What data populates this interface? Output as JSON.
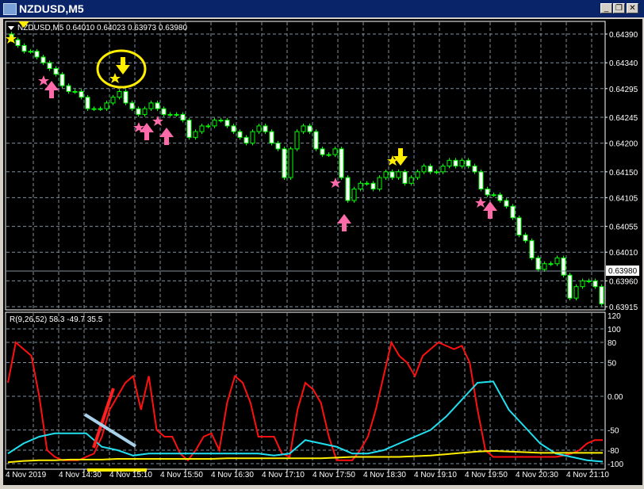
{
  "window": {
    "title": "NZDUSD,M5",
    "buttons": [
      "minimize",
      "restore",
      "close"
    ]
  },
  "chart": {
    "header": "NZDUSD,M5  0.64010 0.64023 0.63973 0.63980",
    "current_price": "0.63980",
    "price_labels": [
      "0.64390",
      "0.64340",
      "0.64295",
      "0.64245",
      "0.64200",
      "0.64150",
      "0.64105",
      "0.64055",
      "0.64010",
      "0.63960",
      "0.63915"
    ],
    "closes": [
      0.6438,
      0.6437,
      0.6436,
      0.6436,
      0.6435,
      0.6434,
      0.6433,
      0.6432,
      0.643,
      0.6429,
      0.6429,
      0.6428,
      0.6426,
      0.6426,
      0.6426,
      0.6427,
      0.6428,
      0.6429,
      0.6427,
      0.6426,
      0.6425,
      0.6426,
      0.6427,
      0.6426,
      0.6425,
      0.6425,
      0.6425,
      0.6424,
      0.6421,
      0.6422,
      0.6423,
      0.6423,
      0.6424,
      0.6424,
      0.6423,
      0.6422,
      0.6421,
      0.642,
      0.6422,
      0.6423,
      0.6422,
      0.642,
      0.6419,
      0.6414,
      0.6419,
      0.6422,
      0.6423,
      0.6422,
      0.6419,
      0.6418,
      0.6418,
      0.6419,
      0.6414,
      0.641,
      0.6412,
      0.6413,
      0.6413,
      0.6412,
      0.6414,
      0.6415,
      0.6414,
      0.6415,
      0.6413,
      0.6414,
      0.6415,
      0.6416,
      0.6415,
      0.6415,
      0.6416,
      0.6417,
      0.6416,
      0.6417,
      0.6416,
      0.6415,
      0.6412,
      0.6411,
      0.6411,
      0.641,
      0.6409,
      0.6407,
      0.6404,
      0.6403,
      0.64,
      0.6398,
      0.6399,
      0.6399,
      0.64,
      0.6397,
      0.6393,
      0.6395,
      0.6396,
      0.6396,
      0.6395,
      0.6392
    ],
    "colors": {
      "candle": "#00ff00",
      "grid": "#8090a0",
      "buy_arrow": "#ff6aa8",
      "sell_arrow": "#ffee00"
    }
  },
  "indicator": {
    "label": "R(9,26,52) 58.3 -49.7 35.5",
    "axis_labels": [
      "120",
      "100",
      "80",
      "50",
      "0.00",
      "-50",
      "-80",
      "-100"
    ],
    "red": [
      20,
      80,
      70,
      60,
      0,
      -80,
      -90,
      -95,
      -95,
      -95,
      -90,
      -85,
      -60,
      -20,
      0,
      20,
      30,
      -20,
      30,
      -50,
      -60,
      -60,
      -85,
      -95,
      -80,
      -60,
      -55,
      -80,
      -10,
      30,
      20,
      -10,
      -60,
      -60,
      -60,
      -85,
      -90,
      -20,
      20,
      10,
      -10,
      -60,
      -95,
      -95,
      -95,
      -80,
      -60,
      -20,
      30,
      80,
      60,
      50,
      30,
      60,
      70,
      80,
      75,
      70,
      75,
      50,
      -20,
      -80,
      -90,
      -90,
      -90,
      -90,
      -90,
      -90,
      -90,
      -90,
      -90,
      -88,
      -85,
      -80,
      -70,
      -65,
      -65
    ],
    "cyan": [
      -85,
      -70,
      -60,
      -55,
      -55,
      -55,
      -75,
      -80,
      -88,
      -85,
      -85,
      -85,
      -85,
      -85,
      -85,
      -85,
      -85,
      -88,
      -85,
      -65,
      -70,
      -75,
      -85,
      -85,
      -80,
      -70,
      -60,
      -50,
      -30,
      -5,
      20,
      22,
      -20,
      -45,
      -70,
      -85,
      -90,
      -95,
      -97
    ],
    "yellow": [
      -98,
      -96,
      -95,
      -95,
      -94,
      -94,
      -94,
      -93,
      -93,
      -93,
      -93,
      -93,
      -93,
      -93,
      -92,
      -92,
      -92,
      -92,
      -92,
      -92,
      -92,
      -91,
      -90,
      -90,
      -90,
      -90,
      -89,
      -88,
      -86,
      -84,
      -82,
      -81,
      -82,
      -83,
      -84,
      -84,
      -84,
      -84,
      -84
    ]
  },
  "time_labels": [
    "4 Nov 2019",
    "4 Nov 14:30",
    "4 Nov 15:10",
    "4 Nov 15:50",
    "4 Nov 16:30",
    "4 Nov 17:10",
    "4 Nov 17:50",
    "4 Nov 18:30",
    "4 Nov 19:10",
    "4 Nov 19:50",
    "4 Nov 20:30",
    "4 Nov 21:10"
  ]
}
